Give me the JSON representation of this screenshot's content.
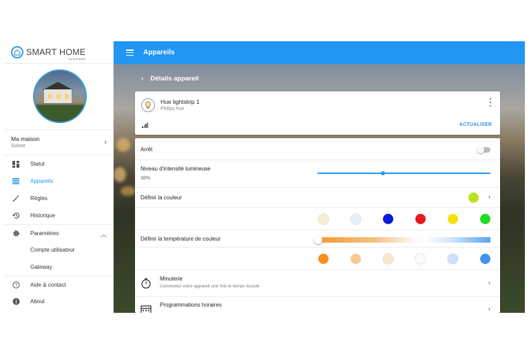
{
  "app": {
    "logo_text": "SMART HOME",
    "logo_sub": "by hornbach"
  },
  "sidebar": {
    "home": {
      "name": "Ma maison",
      "location": "Suisse"
    },
    "items": [
      {
        "label": "Statut",
        "icon": "grid-icon"
      },
      {
        "label": "Appareils",
        "icon": "list-icon",
        "active": true
      },
      {
        "label": "Règles",
        "icon": "magic-wand-icon"
      },
      {
        "label": "Historique",
        "icon": "history-icon"
      },
      {
        "label": "Paramètres",
        "icon": "gear-icon"
      },
      {
        "label": "Compte utilisateur"
      },
      {
        "label": "Gateway"
      },
      {
        "label": "Aide & contact",
        "icon": "help-icon"
      },
      {
        "label": "About",
        "icon": "info-icon"
      }
    ]
  },
  "topbar": {
    "title": "Appareils"
  },
  "subheader": {
    "title": "Détails appareil"
  },
  "device": {
    "name": "Hue lightstrip 1",
    "vendor": "Philips hue",
    "update_label": "ACTUALISER"
  },
  "settings": {
    "power_label": "Arrêt",
    "power_on": false,
    "brightness_label": "Niveau d'intensité lumineuse",
    "brightness_value": "38%",
    "brightness_fraction": 0.38,
    "color_label": "Définir la couleur",
    "current_color": "#b9e21f",
    "color_swatches": [
      "#fbebd2",
      "#e6f0fa",
      "#0a1ad8",
      "#e8181f",
      "#f2e20a",
      "#22dd22"
    ],
    "temp_label": "Définir la température de couleur",
    "temp_fraction": 0.0,
    "temp_swatches": [
      "#f4901b",
      "#f6c994",
      "#fbe6d2",
      "#fbfbfb",
      "#cde3fa",
      "#3f94ea"
    ],
    "timer_title": "Minuterie",
    "timer_desc": "Commutez votre appareil une fois le temps écoulé",
    "schedule_title": "Programmations horaires"
  }
}
